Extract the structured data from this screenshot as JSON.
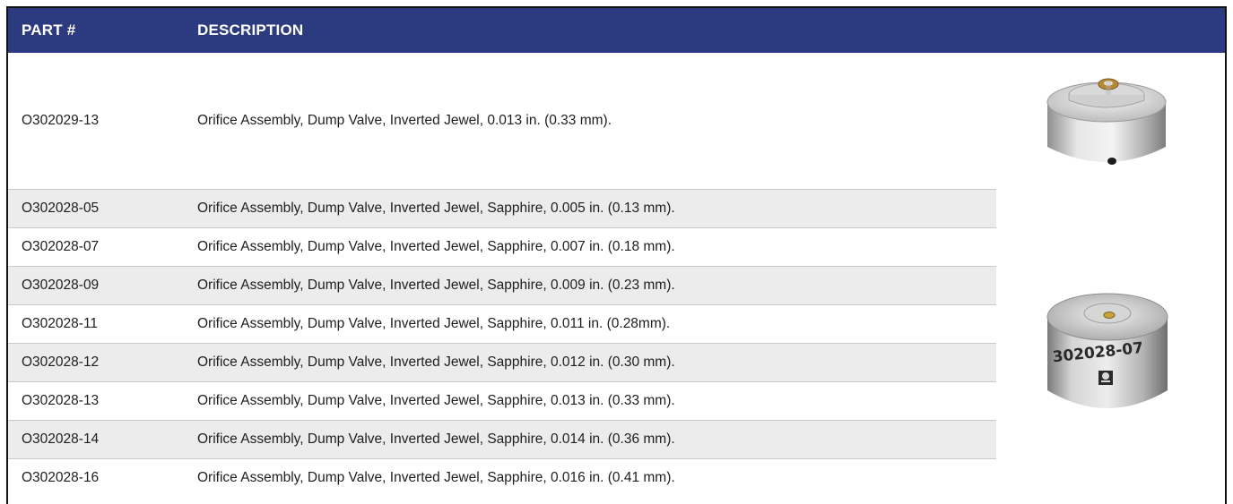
{
  "table": {
    "headers": {
      "part": "PART #",
      "description": "DESCRIPTION"
    },
    "rows": [
      {
        "part": "O302029-13",
        "description": "Orifice Assembly, Dump Valve, Inverted Jewel, 0.013 in. (0.33 mm)."
      },
      {
        "part": "O302028-05",
        "description": "Orifice Assembly, Dump Valve, Inverted Jewel, Sapphire, 0.005 in. (0.13 mm)."
      },
      {
        "part": "O302028-07",
        "description": "Orifice Assembly, Dump Valve, Inverted Jewel, Sapphire, 0.007 in. (0.18 mm)."
      },
      {
        "part": "O302028-09",
        "description": "Orifice Assembly, Dump Valve, Inverted Jewel, Sapphire, 0.009 in. (0.23 mm)."
      },
      {
        "part": "O302028-11",
        "description": "Orifice Assembly, Dump Valve, Inverted Jewel, Sapphire, 0.011 in. (0.28mm)."
      },
      {
        "part": "O302028-12",
        "description": "Orifice Assembly, Dump Valve, Inverted Jewel, Sapphire, 0.012 in. (0.30 mm)."
      },
      {
        "part": "O302028-13",
        "description": "Orifice Assembly, Dump Valve, Inverted Jewel, Sapphire, 0.013 in. (0.33 mm)."
      },
      {
        "part": "O302028-14",
        "description": "Orifice Assembly, Dump Valve, Inverted Jewel, Sapphire, 0.014 in. (0.36 mm)."
      },
      {
        "part": "O302028-16",
        "description": "Orifice Assembly, Dump Valve, Inverted Jewel, Sapphire, 0.016 in. (0.41 mm)."
      }
    ]
  },
  "images": {
    "orifice_top": {
      "icon": "orifice-assembly-photo"
    },
    "orifice_bottom": {
      "icon": "orifice-assembly-photo",
      "engraving": "302028-07"
    }
  },
  "colors": {
    "header_bg": "#2c3a7f",
    "row_shade": "#ececec"
  }
}
